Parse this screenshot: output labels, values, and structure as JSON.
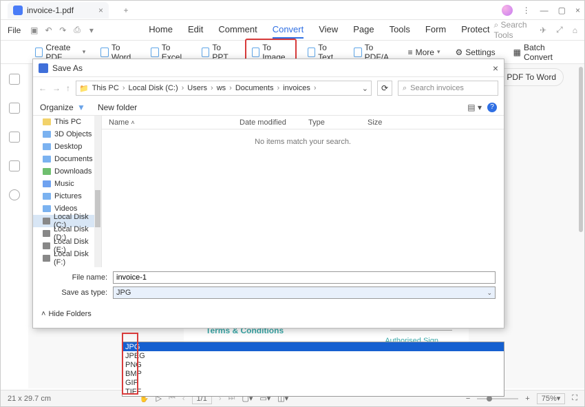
{
  "titlebar": {
    "tab_name": "invoice-1.pdf"
  },
  "menubar": {
    "file": "File",
    "items": [
      "Home",
      "Edit",
      "Comment",
      "Convert",
      "View",
      "Page",
      "Tools",
      "Form",
      "Protect"
    ],
    "active_index": 3,
    "search_placeholder": "Search Tools"
  },
  "toolbar": {
    "create": "Create PDF",
    "toword": "To Word",
    "toexcel": "To Excel",
    "toppt": "To PPT",
    "toimage": "To Image",
    "totext": "To Text",
    "topdfa": "To PDF/A",
    "more": "More",
    "settings": "Settings",
    "batch": "Batch Convert",
    "pdf2word_pill": "PDF To Word"
  },
  "dialog": {
    "title": "Save As",
    "path_segments": [
      "This PC",
      "Local Disk (C:)",
      "Users",
      "ws",
      "Documents",
      "invoices"
    ],
    "search_placeholder": "Search invoices",
    "organize": "Organize",
    "newfolder": "New folder",
    "columns": {
      "name": "Name",
      "date": "Date modified",
      "type": "Type",
      "size": "Size"
    },
    "noitems": "No items match your search.",
    "tree": [
      "This PC",
      "3D Objects",
      "Desktop",
      "Documents",
      "Downloads",
      "Music",
      "Pictures",
      "Videos",
      "Local Disk (C:)",
      "Local Disk (D:)",
      "Local Disk (E:)",
      "Local Disk (F:)"
    ],
    "tree_selected_index": 8,
    "filename_label": "File name:",
    "filename_value": "invoice-1",
    "saveastype_label": "Save as type:",
    "saveastype_value": "JPG",
    "dropdown_options": [
      "JPG",
      "JPEG",
      "PNG",
      "BMP",
      "GIF",
      "TIFF"
    ],
    "dropdown_selected_index": 0,
    "hidefolders": "Hide Folders"
  },
  "paper": {
    "terms": "Terms & Conditions",
    "auth": "Authorised Sign"
  },
  "status": {
    "dims": "21 x 29.7 cm",
    "page_cur": "1",
    "page_total": "/1",
    "zoom": "75%"
  }
}
